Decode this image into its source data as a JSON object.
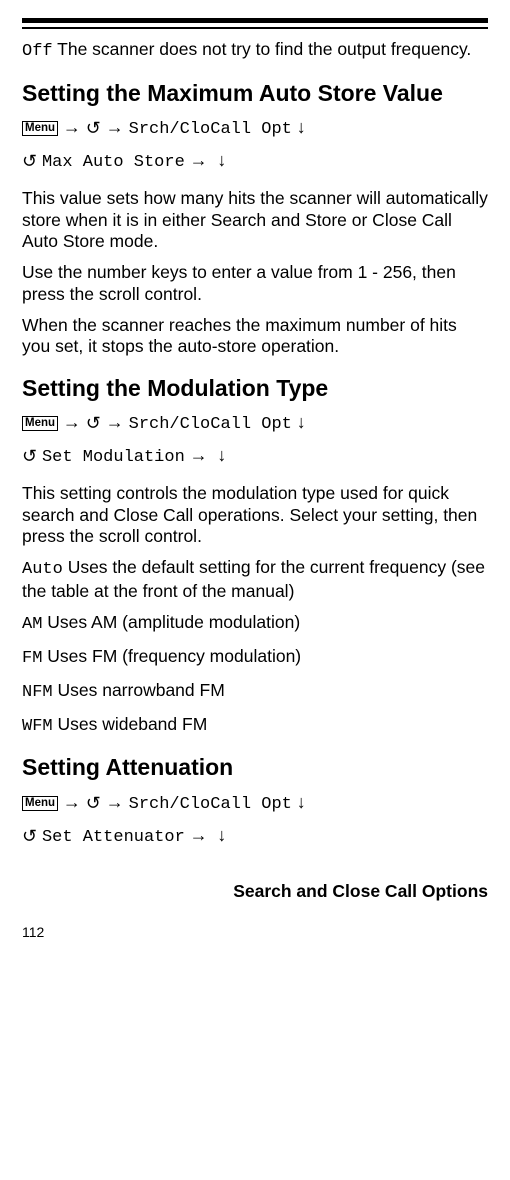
{
  "intro": {
    "off_label": "Off",
    "off_text": "  The scanner does not try to find the output frequency."
  },
  "section1": {
    "title": "Setting the Maximum Auto Store Value",
    "menu_label": "Menu",
    "nav_text1": "Srch/CloCall Opt",
    "nav_text2": "Max Auto Store",
    "para1": "This value sets how many hits the scanner will automatically store when it is in either Search and Store or Close Call Auto Store mode.",
    "para2": "Use the number keys to enter a value from 1 - 256, then press the scroll control.",
    "para3": "When the scanner reaches the maximum number of hits you set, it stops the auto-store operation."
  },
  "section2": {
    "title": "Setting the Modulation Type",
    "menu_label": "Menu",
    "nav_text1": "Srch/CloCall Opt",
    "nav_text2": "Set Modulation",
    "para1": "This setting controls the modulation type used for quick search and Close Call operations. Select your setting, then press the scroll control.",
    "auto_label": "Auto",
    "auto_text": " Uses the default setting for the current frequency (see the table at the front of the manual)",
    "am_label": "AM",
    "am_text": "   Uses AM (amplitude modulation)",
    "fm_label": "FM",
    "fm_text": "  Uses FM (frequency modulation)",
    "nfm_label": "NFM",
    "nfm_text": " Uses narrowband FM",
    "wfm_label": "WFM",
    "wfm_text": " Uses wideband FM"
  },
  "section3": {
    "title": "Setting Attenuation",
    "menu_label": "Menu",
    "nav_text1": "Srch/CloCall Opt",
    "nav_text2": "Set Attenuator"
  },
  "footer": {
    "title": "Search and Close Call Options",
    "page_num": "112"
  },
  "glyphs": {
    "arrow_right": "→",
    "arrow_down": "↓",
    "scroll": "↺"
  }
}
